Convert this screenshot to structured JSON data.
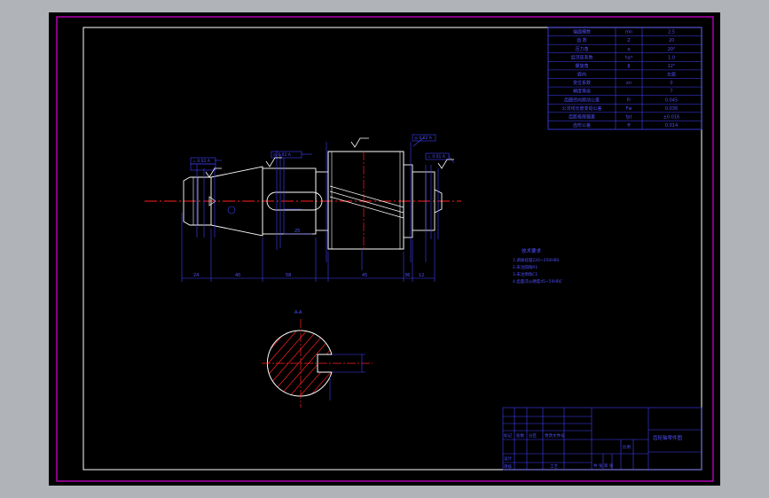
{
  "colors": {
    "background": "#000000",
    "window_frame": "#b0b4b8",
    "sheet_border": "#cc00cc",
    "frame_line": "#ffffff",
    "dimension": "#4040ff",
    "centerline": "#ff2020",
    "geometry": "#ffffff",
    "hatch": "#ff2020"
  },
  "gear_table": {
    "rows": [
      [
        "端面模数",
        "mn",
        "2.5"
      ],
      [
        "齿 数",
        "Z",
        "20"
      ],
      [
        "压力角",
        "α",
        "20°"
      ],
      [
        "齿顶高系数",
        "ha*",
        "1.0"
      ],
      [
        "螺旋角",
        "β",
        "12°"
      ],
      [
        "旋向",
        "",
        "左旋"
      ],
      [
        "变位系数",
        "xn",
        "0"
      ],
      [
        "精度等级",
        "",
        "7"
      ],
      [
        "齿圈径向跳动公差",
        "Fr",
        "0.045"
      ],
      [
        "公法线长度变动公差",
        "Fw",
        "0.036"
      ],
      [
        "齿距极限偏差",
        "fpt",
        "±0.016"
      ],
      [
        "齿形公差",
        "ff",
        "0.014"
      ]
    ]
  },
  "annotations": {
    "gtol_1": "⊥ 0.02 A",
    "gtol_2": "◎ 0.02 A",
    "gtol_3": "◎ 0.02 A",
    "gtol_4": "⊥ 0.01 A",
    "section_label": "A-A"
  },
  "dimensions": {
    "d1": "24",
    "d2": "40",
    "d3": "58",
    "d4": "45",
    "d5": "36",
    "d6": "12",
    "d7": "25"
  },
  "tech_notes": {
    "title": "技术要求",
    "lines": [
      "1.调质处理220~250HBS",
      "2.未注圆角R1",
      "3.未注倒角C1",
      "4.齿面淬火硬度45~50HRC"
    ]
  },
  "title_block": {
    "drawing_name": "齿轮轴零件图",
    "row_labels": [
      "标记",
      "处数",
      "分区",
      "更改文件号"
    ],
    "sign_labels": [
      "设计",
      "审核",
      "工艺"
    ],
    "scale_label": "比例",
    "sheet_label": "共 张 第 张"
  }
}
